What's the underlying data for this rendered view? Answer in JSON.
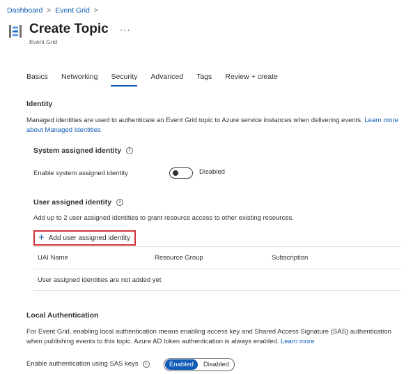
{
  "breadcrumb": [
    {
      "label": "Dashboard"
    },
    {
      "label": "Event Grid"
    }
  ],
  "breadcrumb_separator": ">",
  "header": {
    "title": "Create Topic",
    "subtitle": "Event Grid",
    "more_label": "···"
  },
  "tabs": [
    {
      "label": "Basics"
    },
    {
      "label": "Networking"
    },
    {
      "label": "Security",
      "active": true
    },
    {
      "label": "Advanced"
    },
    {
      "label": "Tags"
    },
    {
      "label": "Review + create"
    }
  ],
  "identity": {
    "heading": "Identity",
    "description": "Managed identities are used to authenticate an Event Grid topic to Azure service instances when delivering events.",
    "link_label": "Learn more about Managed Identities",
    "system": {
      "heading": "System assigned identity",
      "field_label": "Enable system assigned identity",
      "toggle_state": "Disabled"
    },
    "user": {
      "heading": "User assigned identity",
      "description": "Add up to 2 user assigned identities to grant resource access to other existing resources.",
      "add_button_label": "Add user assigned identity",
      "columns": [
        "UAI Name",
        "Resource Group",
        "Subscription"
      ],
      "empty_message": "User assigned identities are not added yet"
    }
  },
  "local_auth": {
    "heading": "Local Authentication",
    "description": "For Event Grid, enabling local authentication means enabling access key and Shared Access Signature (SAS) authentication when publishing events to this topic. Azure AD token authentication is always enabled.",
    "link_label": "Learn more",
    "field_label": "Enable authentication using SAS keys",
    "options": [
      "Enabled",
      "Disabled"
    ],
    "selected": "Enabled"
  },
  "info_glyph": "i",
  "colors": {
    "link": "#0f5bb5",
    "highlight_border": "#d13438"
  }
}
